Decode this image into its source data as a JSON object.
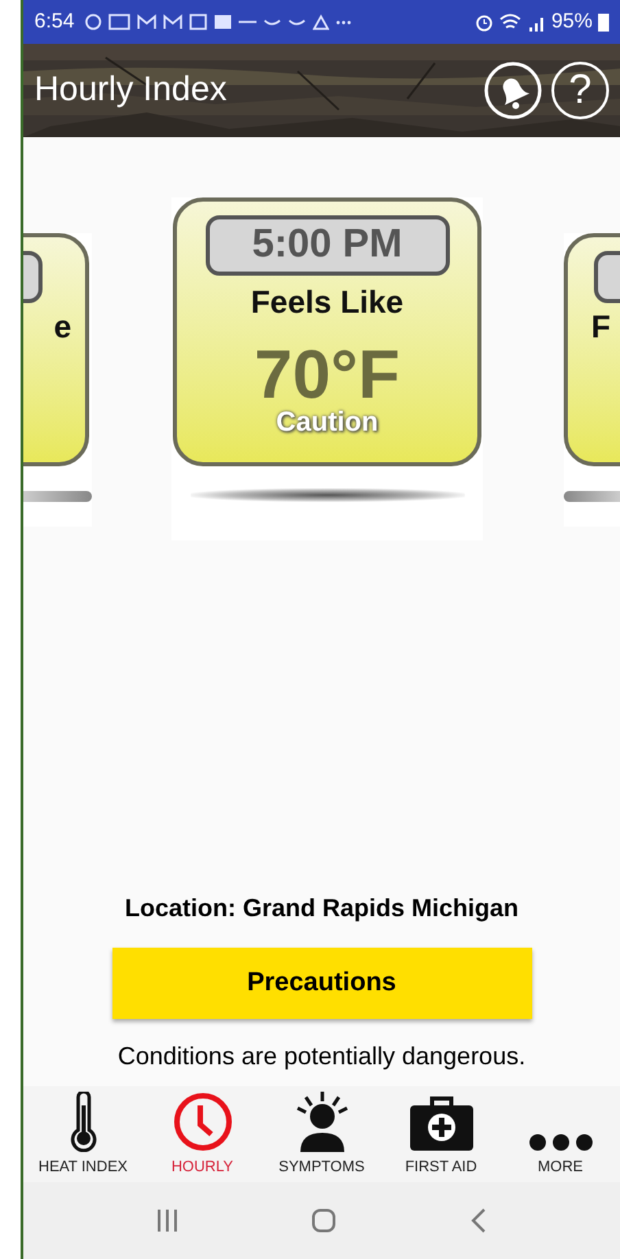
{
  "status_bar": {
    "time": "6:54",
    "battery": "95%"
  },
  "header": {
    "title": "Hourly Index",
    "help_label": "?"
  },
  "cards": [
    {
      "kind": "partial_left",
      "label": "e"
    },
    {
      "kind": "full",
      "time": "5:00 PM",
      "label": "Feels Like",
      "temperature": "70°F",
      "status": "Caution"
    },
    {
      "kind": "partial_right",
      "label": "F"
    }
  ],
  "location": "Location: Grand Rapids Michigan",
  "precautions_button": "Precautions",
  "message": "Conditions are potentially dangerous.",
  "nav": [
    {
      "kind": "thermometer",
      "label": "HEAT INDEX",
      "selected": false
    },
    {
      "kind": "clock",
      "label": "HOURLY",
      "selected": true
    },
    {
      "kind": "symptoms",
      "label": "SYMPTOMS",
      "selected": false
    },
    {
      "kind": "firstaid",
      "label": "FIRST AID",
      "selected": false
    },
    {
      "kind": "more",
      "label": "MORE",
      "selected": false
    }
  ]
}
